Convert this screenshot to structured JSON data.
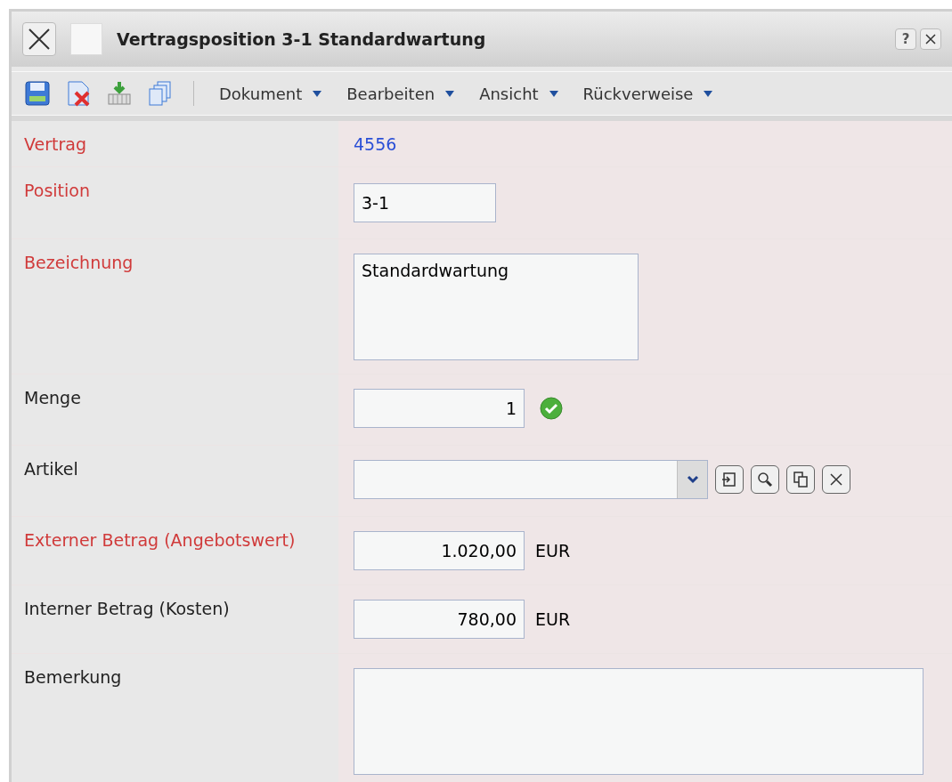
{
  "window": {
    "title": "Vertragsposition 3-1 Standardwartung",
    "help": "?"
  },
  "menus": [
    {
      "label": "Dokument"
    },
    {
      "label": "Bearbeiten"
    },
    {
      "label": "Ansicht"
    },
    {
      "label": "Rückverweise"
    }
  ],
  "fields": [
    {
      "kind": "link",
      "label": "Vertrag",
      "required": true,
      "value": "4556"
    },
    {
      "kind": "readonly",
      "label": "Position",
      "required": true,
      "value": "3-1"
    },
    {
      "kind": "textarea",
      "label": "Bezeichnung",
      "required": true,
      "value": "Standardwartung"
    },
    {
      "kind": "number",
      "label": "Menge",
      "required": false,
      "value": "1",
      "valid": true
    },
    {
      "kind": "select",
      "label": "Artikel",
      "required": false
    },
    {
      "kind": "amount",
      "label": "Externer Betrag (Angebotswert)",
      "required": true,
      "value": "1.020,00",
      "unit": "EUR"
    },
    {
      "kind": "amount",
      "label": "Interner Betrag (Kosten)",
      "required": false,
      "value": "780,00",
      "unit": "EUR"
    },
    {
      "kind": "memo",
      "label": "Bemerkung",
      "required": false
    }
  ]
}
